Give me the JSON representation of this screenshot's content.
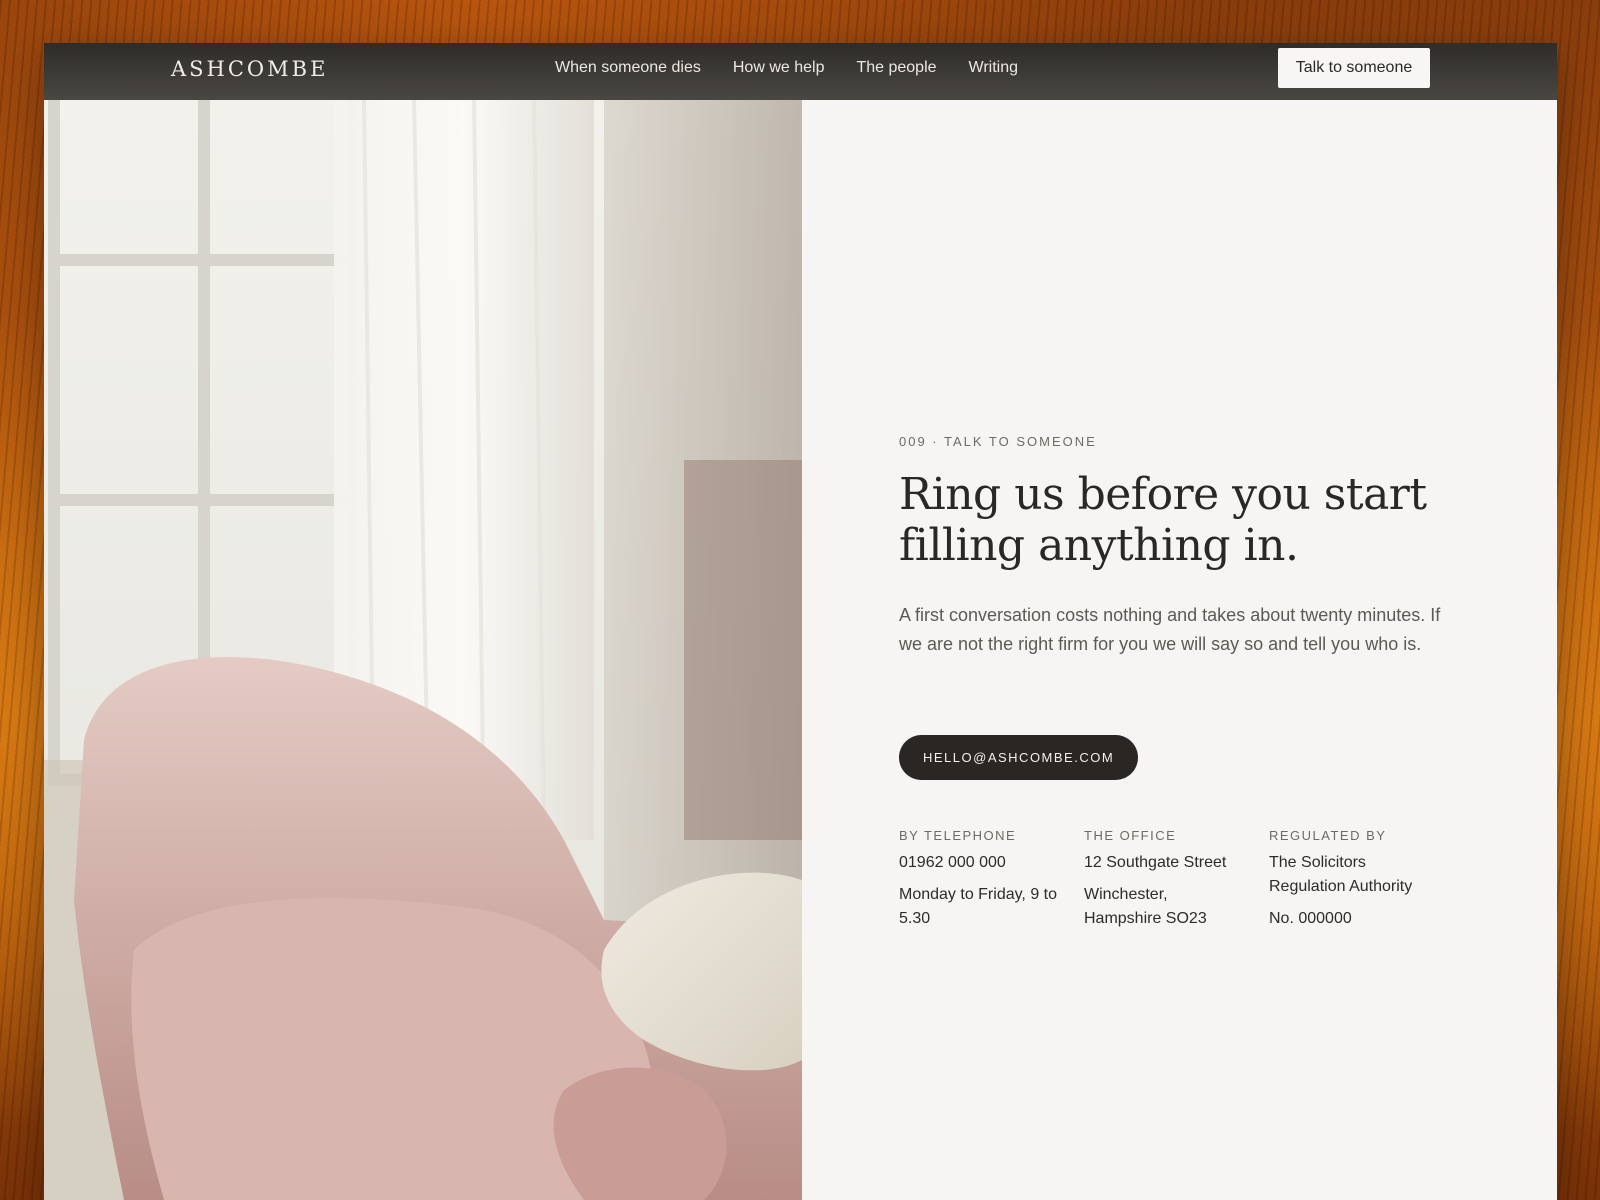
{
  "brand": {
    "logo": "ASHCOMBE"
  },
  "nav": {
    "items": [
      {
        "label": "When someone dies"
      },
      {
        "label": "How we help"
      },
      {
        "label": "The people"
      },
      {
        "label": "Writing"
      }
    ],
    "cta_label": "Talk to someone"
  },
  "hero": {
    "eyebrow": "009 · TALK TO SOMEONE",
    "heading": "Ring us before you start filling anything in.",
    "lede": "A first conversation costs nothing and takes about twenty minutes. If we are not the right firm for you we will say so and tell you who is.",
    "email_button": "HELLO@ASHCOMBE.COM"
  },
  "contact": {
    "columns": [
      {
        "label": "BY TELEPHONE",
        "lines": [
          "01962 000 000",
          "Monday to Friday, 9 to 5.30"
        ]
      },
      {
        "label": "THE OFFICE",
        "lines": [
          "12 Southgate Street",
          "Winchester, Hampshire SO23"
        ]
      },
      {
        "label": "REGULATED BY",
        "lines": [
          "The Solicitors Regulation Authority",
          "No. 000000"
        ]
      }
    ]
  },
  "colors": {
    "accent_dark": "#2a2623",
    "page_background": "#f6f5f3",
    "header": "#3a3835",
    "backdrop": "#b8560f"
  }
}
